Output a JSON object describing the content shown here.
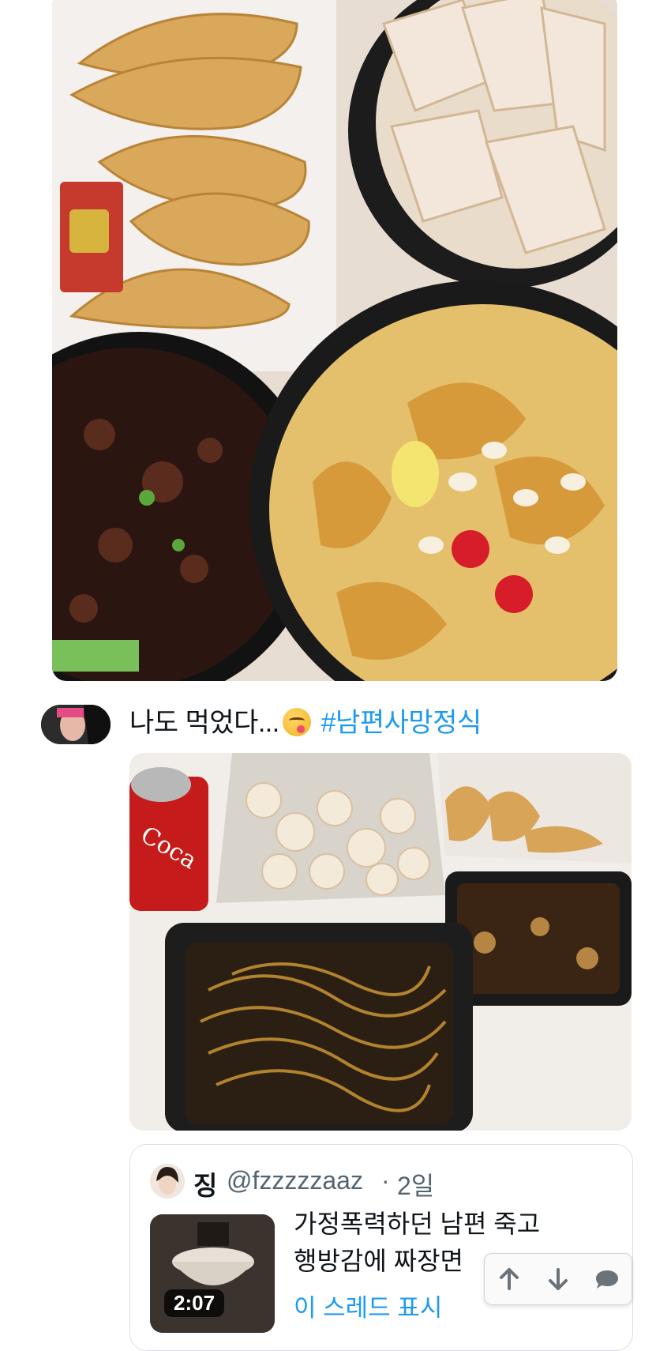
{
  "post": {
    "text": "나도 먹었다...",
    "emoji": "face-savoring-food",
    "hashtag": "#남편사망정식"
  },
  "photos": [
    {
      "name": "top-meal-photo",
      "content": "Fried dumplings, fried pork, jjajang sauce and sweet-and-sour shrimp"
    },
    {
      "name": "takeout-meal-photo",
      "content": "Coca-Cola Zero can, fried pork, dumplings, sauce and jjajangmyeon in takeout boxes"
    }
  ],
  "quote": {
    "name": "징",
    "handle": "@fzzzzzaaz",
    "separator": "·",
    "time": "2일",
    "text_line1": "가정폭력하던 남편 죽고",
    "text_line2": "행방감에 짜장면",
    "show_thread": "이 스레드 표시",
    "video_duration": "2:07"
  },
  "actions": {
    "icons": [
      "arrow-up-icon",
      "arrow-down-icon",
      "comment-icon"
    ]
  },
  "colors": {
    "link": "#1d9bf0",
    "muted": "#536471",
    "text": "#0f1419"
  }
}
